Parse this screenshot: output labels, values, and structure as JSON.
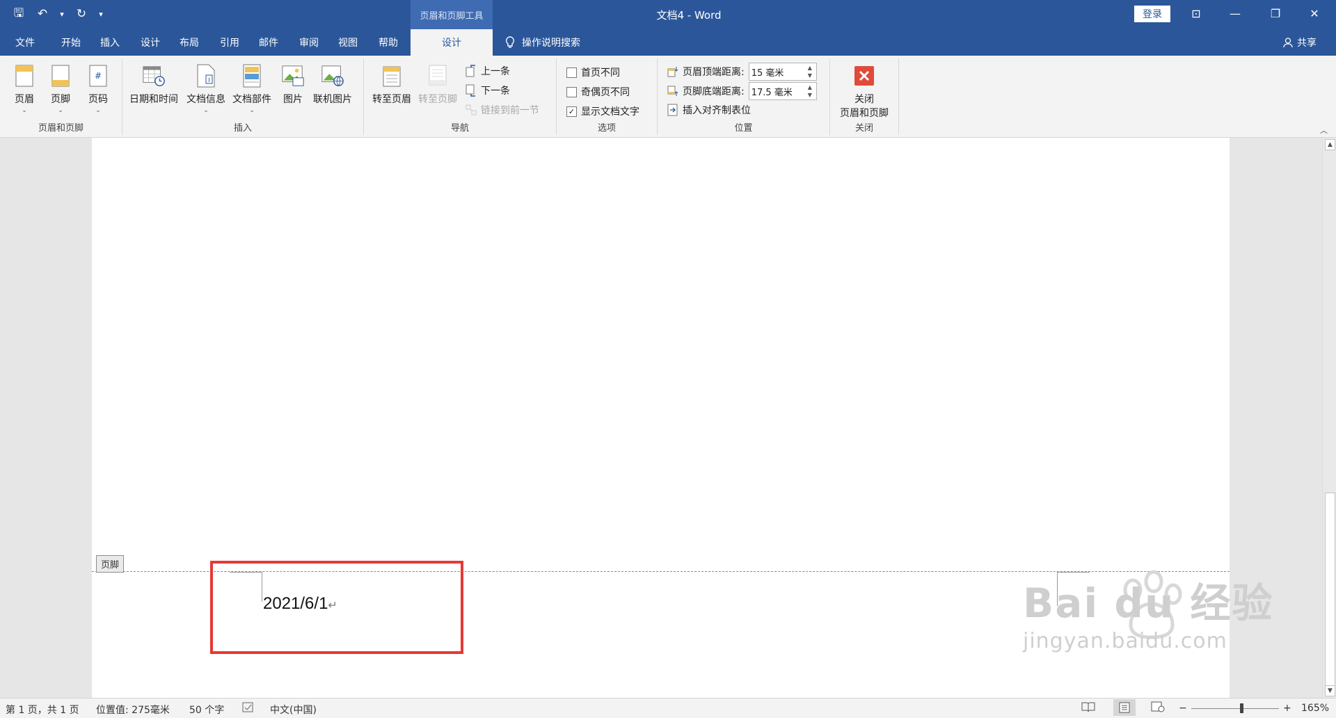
{
  "titlebar": {
    "contextual_tab": "页眉和页脚工具",
    "title": "文档4  -  Word",
    "login": "登录",
    "minimize": "—",
    "close": "✕",
    "restore": "❐",
    "ribbon_display": "⊡"
  },
  "quick_access": {
    "save": "🖫",
    "undo": "↶",
    "undo_dropdown": "▾",
    "redo": "↻",
    "customize": "▾"
  },
  "tabs": [
    "文件",
    "开始",
    "插入",
    "设计",
    "布局",
    "引用",
    "邮件",
    "审阅",
    "视图",
    "帮助"
  ],
  "active_tab": "设计",
  "tell_me": "操作说明搜索",
  "share": "共享",
  "ribbon": {
    "group_header_footer": {
      "label": "页眉和页脚",
      "header": "页眉",
      "footer": "页脚",
      "page_number": "页码"
    },
    "group_insert": {
      "label": "插入",
      "date_time": "日期和时间",
      "doc_info": "文档信息",
      "doc_parts": "文档部件",
      "picture": "图片",
      "online_picture": "联机图片"
    },
    "group_nav": {
      "label": "导航",
      "goto_header": "转至页眉",
      "goto_footer": "转至页脚",
      "previous": "上一条",
      "next": "下一条",
      "link_previous": "链接到前一节"
    },
    "group_options": {
      "label": "选项",
      "different_first": "首页不同",
      "different_odd_even": "奇偶页不同",
      "show_doc_text": "显示文档文字"
    },
    "group_position": {
      "label": "位置",
      "header_from_top": "页眉顶端距离:",
      "header_from_top_value": "15 毫米",
      "footer_from_bottom": "页脚底端距离:",
      "footer_from_bottom_value": "17.5 毫米",
      "insert_align_tab": "插入对齐制表位"
    },
    "group_close": {
      "label": "关闭",
      "close_btn_line1": "关闭",
      "close_btn_line2": "页眉和页脚"
    }
  },
  "document": {
    "footer_tag": "页脚",
    "footer_text": "2021/6/1",
    "paragraph_mark": "↵"
  },
  "watermark": {
    "big": "Bai du 经验",
    "small": "jingyan.baidu.com"
  },
  "status": {
    "page": "第 1 页，共 1 页",
    "position": "位置值: 275毫米",
    "words": "50 个字",
    "language": "中文(中国)",
    "zoom": "165%",
    "zoom_minus": "−",
    "zoom_plus": "+"
  },
  "colors": {
    "brand": "#2b579a",
    "highlight": "#e53935"
  }
}
